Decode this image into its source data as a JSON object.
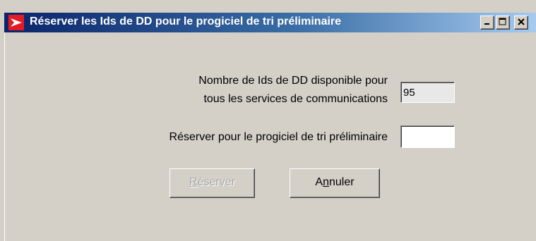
{
  "window": {
    "title": "Réserver les Ids de DD pour  le progiciel de tri préliminaire",
    "icon": "canada-post-logo-icon",
    "controls": {
      "minimize_label": "_",
      "maximize_label": "□",
      "close_label": "×"
    }
  },
  "form": {
    "available_label_line1": "Nombre de Ids de DD disponible pour",
    "available_label_line2": "tous les services de communications",
    "available_value": "95",
    "reserve_label": "Réserver pour le progiciel de tri préliminaire",
    "reserve_value": ""
  },
  "buttons": {
    "reserve": {
      "mnemonic": "R",
      "rest": "éserver",
      "enabled": false
    },
    "cancel": {
      "before": "A",
      "mnemonic": "n",
      "rest": "nuler",
      "enabled": true
    }
  },
  "colors": {
    "titlebar_start": "#0a246a",
    "titlebar_end": "#a6caf0",
    "window_bg": "#d4d0c8",
    "logo_red": "#e31b23"
  }
}
